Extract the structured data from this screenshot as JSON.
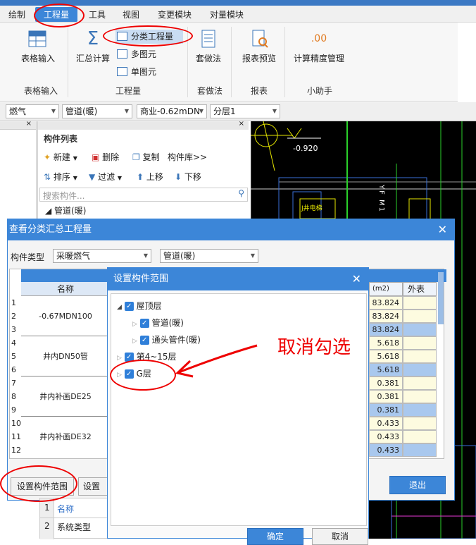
{
  "menu": {
    "items": [
      "绘制",
      "工程量",
      "工具",
      "视图",
      "变更模块",
      "对量模块"
    ]
  },
  "ribbon": {
    "table_input": "表格输入",
    "summary_calc": "汇总计算",
    "classified_qty": "分类工程量",
    "multi_elem": "多图元",
    "single_elem": "单图元",
    "method": "套做法",
    "report_preview": "报表预览",
    "precision": "计算精度管理",
    "groups": [
      "表格输入",
      "工程量",
      "套做法",
      "报表",
      "小助手"
    ],
    "precision_icon_text": ".00"
  },
  "combos": [
    "燃气",
    "管道(暖)",
    "商业-0.62mDN",
    "分层1"
  ],
  "component_list": {
    "title": "构件列表",
    "new": "新建",
    "delete": "删除",
    "copy": "复制",
    "lib": "构件库>>",
    "sort": "排序",
    "filter": "过滤",
    "up": "上移",
    "down": "下移",
    "search_placeholder": "搜索构件...",
    "tree_item": "管道(暖)"
  },
  "cad": {
    "label_elev": "-0.920",
    "label_yf": "YF M1",
    "label_box": "J井电梯"
  },
  "summary_dialog": {
    "title": "查看分类汇总工程量",
    "type_label": "构件类型",
    "type_value": "采暖燃气",
    "sub_value": "管道(暖)",
    "col_name": "名称",
    "col_unit": "(m2)",
    "col_outer": "外表",
    "row_numbers": [
      "1",
      "2",
      "3",
      "4",
      "5",
      "6",
      "7",
      "8",
      "9",
      "10",
      "11",
      "12"
    ],
    "groups": [
      "-0.67MDN100",
      "井内DN50管",
      "井内补画DE25",
      "井内补画DE32"
    ],
    "values": [
      "83.824",
      "83.824",
      "83.824",
      "5.618",
      "5.618",
      "5.618",
      "0.381",
      "0.381",
      "0.381",
      "0.433",
      "0.433",
      "0.433"
    ],
    "set_range_btn": "设置构件范围",
    "set_btn2": "设置分",
    "exit_btn": "退出"
  },
  "bottom_props": {
    "rows": [
      {
        "num": "1",
        "label": "名称"
      },
      {
        "num": "2",
        "label": "系统类型"
      }
    ]
  },
  "range_dialog": {
    "title": "设置构件范围",
    "tree": [
      {
        "label": "屋顶层",
        "indent": 0,
        "expanded": true
      },
      {
        "label": "管道(暖)",
        "indent": 1,
        "expanded": false
      },
      {
        "label": "通头管件(暖)",
        "indent": 1,
        "expanded": false
      },
      {
        "label": "第4~15层",
        "indent": 0,
        "expanded": false
      },
      {
        "label": "G层",
        "indent": 0,
        "expanded": false
      }
    ],
    "ok": "确定",
    "cancel": "取消"
  },
  "annotation": {
    "text": "取消勾选",
    "color": "#e00000"
  }
}
